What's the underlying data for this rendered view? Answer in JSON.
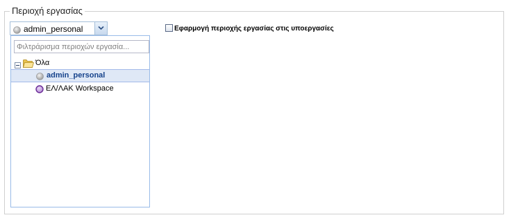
{
  "panel": {
    "title": "Περιοχή εργασίας"
  },
  "combo": {
    "value": "admin_personal",
    "icon": "gray-circle-icon"
  },
  "dropdown": {
    "filter_placeholder": "Φιλτράρισμα περιοχών εργασία..."
  },
  "tree": {
    "root": {
      "label": "Όλα",
      "expanded": true,
      "icon": "folder-open-icon"
    },
    "items": [
      {
        "label": "admin_personal",
        "icon": "gray-circle-icon",
        "selected": true
      },
      {
        "label": "ΕΛ/ΛΑΚ Workspace",
        "icon": "purple-circle-icon",
        "selected": false
      }
    ]
  },
  "apply": {
    "label": "Εφαρμογή περιοχής εργασίας στις υποεργασίες",
    "checked": false
  },
  "colors": {
    "selection_bg": "#dfe8f6",
    "selection_text": "#15428b",
    "border_blue": "#99bbe8",
    "folder_yellow": "#f5d36b",
    "purple": "#7b3fa5"
  }
}
